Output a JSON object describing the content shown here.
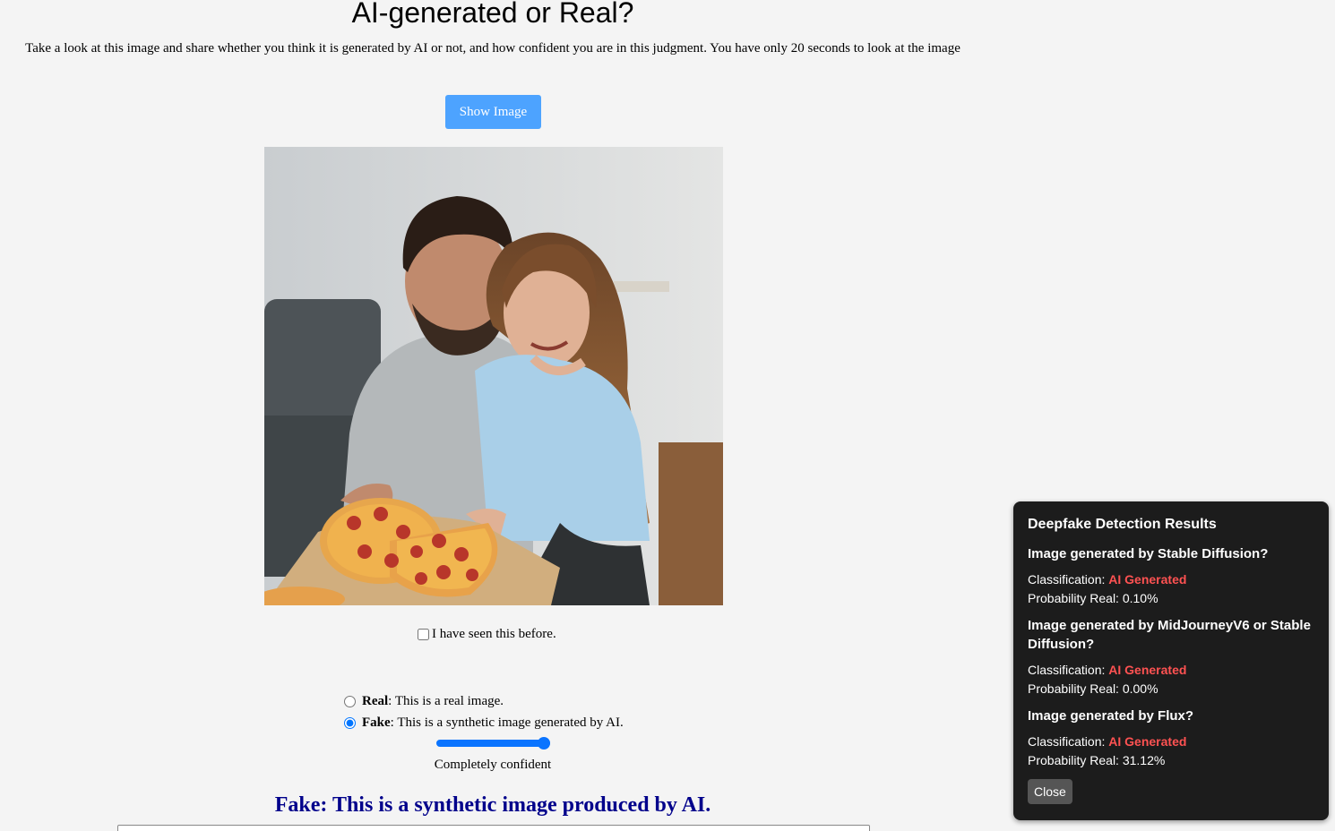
{
  "page": {
    "title": "AI-generated or Real?",
    "instructions": "Take a look at this image and share whether you think it is generated by AI or not, and how confident you are in this judgment. You have only 20 seconds to look at the image",
    "show_image_label": "Show Image"
  },
  "image": {
    "subject": "photo of a smiling couple sharing a pepperoni pizza on a sofa"
  },
  "seen_checkbox": {
    "checked": false,
    "label": "I have seen this before."
  },
  "choices": {
    "real": {
      "label": "Real",
      "desc": ": This is a real image.",
      "selected": false
    },
    "fake": {
      "label": "Fake",
      "desc": ": This is a synthetic image generated by AI.",
      "selected": true
    }
  },
  "confidence": {
    "value": 1.0,
    "label": "Completely confident"
  },
  "verdict": "Fake: This is a synthetic image produced by AI.",
  "detection_panel": {
    "title": "Deepfake Detection Results",
    "classification_label": "Classification:",
    "probability_label": "Probability Real:",
    "results": [
      {
        "question": "Image generated by Stable Diffusion?",
        "classification": "AI Generated",
        "probability": "0.10%"
      },
      {
        "question": "Image generated by MidJourneyV6 or Stable Diffusion?",
        "classification": "AI Generated",
        "probability": "0.00%"
      },
      {
        "question": "Image generated by Flux?",
        "classification": "AI Generated",
        "probability": "31.12%"
      }
    ],
    "close_label": "Close"
  },
  "colors": {
    "button_blue": "#4da3ff",
    "accent_blue": "#0a74ff",
    "verdict": "#00008b",
    "panel_bg": "#1c1c1c",
    "ai_red": "#ff5252"
  }
}
